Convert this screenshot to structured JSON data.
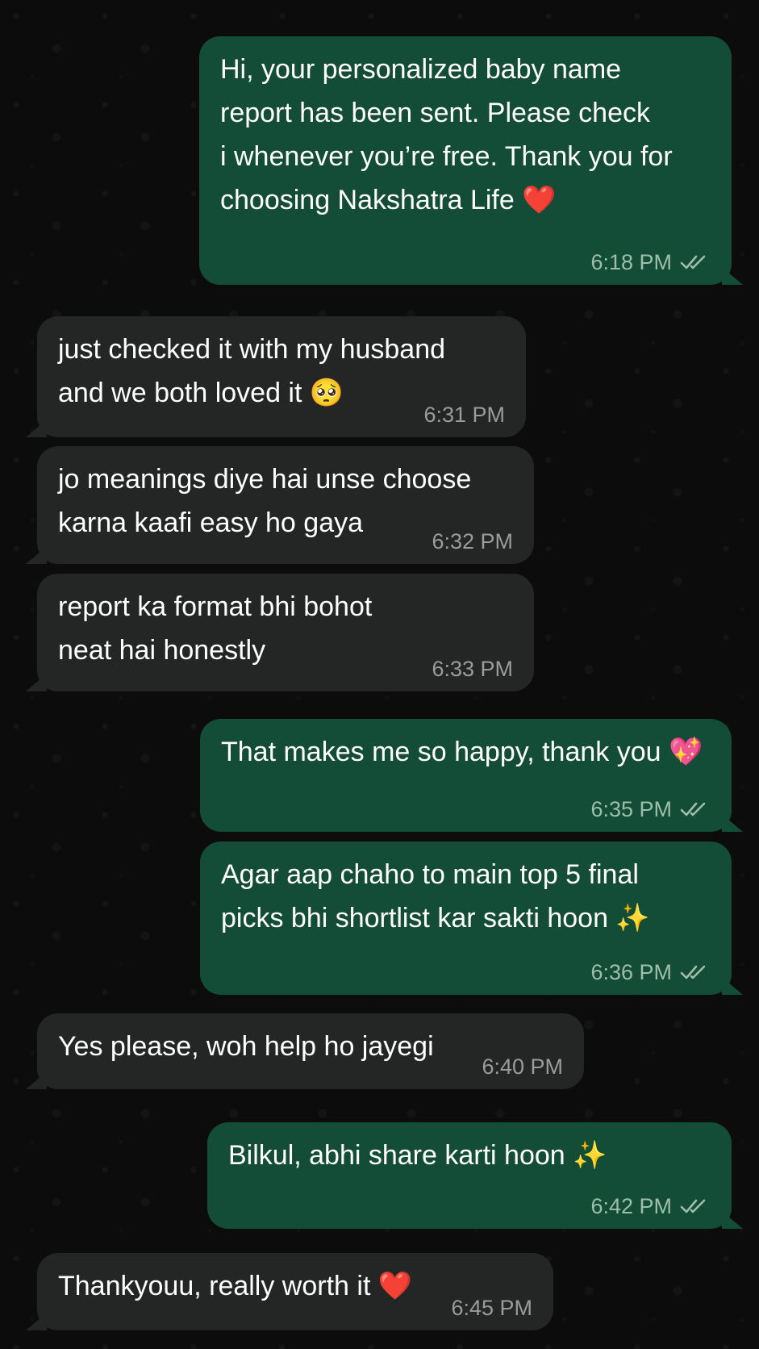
{
  "messages": [
    {
      "direction": "outgoing",
      "lines": [
        "Hi, your personalized baby name",
        "report has been sent. Please check",
        "i whenever you’re free. Thank you for",
        "choosing Nakshatra Life ❤️"
      ],
      "time": "6:18 PM",
      "read_icon": "double-check-icon"
    },
    {
      "direction": "incoming",
      "lines": [
        "just checked it with my husband",
        "and we both loved it 🥺"
      ],
      "time": "6:31 PM"
    },
    {
      "direction": "incoming",
      "lines": [
        "jo meanings diye hai unse choose",
        "karna kaafi easy ho gaya"
      ],
      "time": "6:32 PM"
    },
    {
      "direction": "incoming",
      "lines": [
        "report ka format bhi bohot",
        "neat hai honestly"
      ],
      "time": "6:33 PM"
    },
    {
      "direction": "outgoing",
      "lines": [
        "That makes me so happy, thank you 💖"
      ],
      "time": "6:35 PM",
      "read_icon": "double-check-icon"
    },
    {
      "direction": "outgoing",
      "lines": [
        "Agar aap chaho to main top 5 final",
        "picks bhi shortlist kar sakti hoon ✨"
      ],
      "time": "6:36 PM",
      "read_icon": "double-check-icon"
    },
    {
      "direction": "incoming",
      "lines": [
        "Yes please, woh help ho jayegi"
      ],
      "time": "6:40 PM"
    },
    {
      "direction": "outgoing",
      "lines": [
        "Bilkul, abhi share karti hoon ✨"
      ],
      "time": "6:42 PM",
      "read_icon": "double-check-icon"
    },
    {
      "direction": "incoming",
      "lines": [
        "Thankyouu, really worth it ❤️"
      ],
      "time": "6:45 PM"
    }
  ],
  "colors": {
    "outgoing_bubble": "#144d37",
    "incoming_bubble": "#242626",
    "background": "#0c0c0c"
  }
}
